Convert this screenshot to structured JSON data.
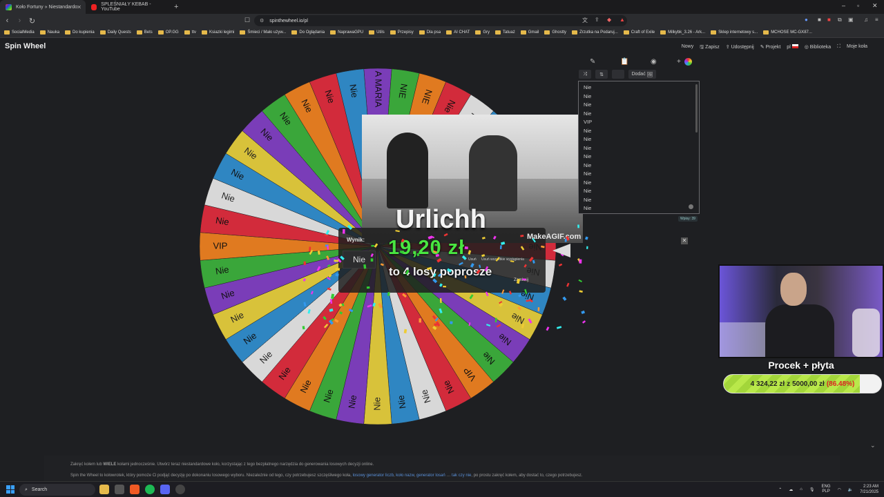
{
  "browser": {
    "tabs": [
      {
        "title": "Koło Fortuny » Niestandardo",
        "active": true
      },
      {
        "title": "SPLEŚNIAŁY KEBAB - YouTube",
        "active": false
      }
    ],
    "url": "spinthewheel.io/pl",
    "bookmarks": [
      "SocialMedia",
      "Nauka",
      "Do kupienia",
      "Daily Quests",
      "Bets",
      "OP.GG",
      "ttv",
      "Ksiazki legimi",
      "Śmieci / Mało używ...",
      "Do Oglądania",
      "NaprawaGPU",
      "Utils",
      "Przepisy",
      "Dla psa",
      "AI CHAT",
      "Gry",
      "Tatuaż",
      "Gmail",
      "Ghostty",
      "Zrzutka na Podaruj...",
      "Craft of Exile",
      "Milkybk_3.26 - Ark...",
      "Sklep internetowy s...",
      "MCHOSE MC-GX87..."
    ]
  },
  "site": {
    "logo": "Spin Wheel",
    "menu": [
      "Nowy",
      "Zapisz",
      "Udostępnij",
      "Projekt",
      "pl",
      "Biblioteka",
      "Moje koła"
    ]
  },
  "wheel": {
    "labels": [
      "A MARIA",
      "NIE",
      "NIE",
      "Nie",
      "Nie",
      "Nie",
      "Nie",
      "Nie",
      "Nie",
      "Nie",
      "Nie",
      "Nie",
      "Nie",
      "Nie",
      "Nie",
      "Nie",
      "VIP",
      "Nie",
      "Nie",
      "Nie",
      "Nie",
      "Nie",
      "Nie",
      "Nie",
      "Nie",
      "Nie",
      "Nie",
      "Nie",
      "Nie",
      "Nie",
      "VIP",
      "Nie",
      "Nie",
      "Nie",
      "Nie",
      "Nie",
      "Nie",
      "Nie",
      "Nie",
      "Nie"
    ],
    "colors": [
      "#7a3db8",
      "#3aa63a",
      "#e07a20",
      "#d22b3b",
      "#d8d8d8",
      "#2f86c2",
      "#d8c23a",
      "#7a3db8",
      "#3aa63a",
      "#e07a20",
      "#d22b3b",
      "#d8d8d8",
      "#2f86c2",
      "#d8c23a",
      "#7a3db8",
      "#3aa63a",
      "#e07a20",
      "#d22b3b",
      "#d8d8d8",
      "#2f86c2",
      "#d8c23a",
      "#7a3db8",
      "#3aa63a",
      "#e07a20",
      "#d22b3b",
      "#d8d8d8",
      "#2f86c2",
      "#d8c23a",
      "#7a3db8",
      "#3aa63a",
      "#e07a20",
      "#d22b3b",
      "#d8d8d8",
      "#2f86c2",
      "#d8c23a",
      "#7a3db8",
      "#3aa63a",
      "#e07a20",
      "#d22b3b",
      "#2f86c2"
    ]
  },
  "alert": {
    "title": "Urlichh",
    "amount": "19,20 zł",
    "message": "to 4 losy poprosze",
    "watermark": "MakeAGIF.com"
  },
  "result_dialog": {
    "label": "Wynik:",
    "value": "Nie",
    "remove": "Usuń",
    "remove_all": "Usuń wszystkie wystąpienia",
    "close": "Zamknij"
  },
  "panel": {
    "add_button": "Dodać",
    "entries": [
      "Nie",
      "Nie",
      "Nie",
      "Nie",
      "VIP",
      "Nie",
      "Nie",
      "Nie",
      "Nie",
      "Nie",
      "Nie",
      "Nie",
      "Nie",
      "Nie",
      "Nie"
    ],
    "count": "Wpisy: 39"
  },
  "goal": {
    "title": "Procek + płyta",
    "current": "4 324,22 zł",
    "separator": "z",
    "target": "5000,00 zł",
    "percent_text": "(86.48%)",
    "progress": 0.8648
  },
  "footer": {
    "line1_prefix": "Zakręć kołem lub ",
    "line1_bold": "WIELE",
    "line1_rest": " kołami jednocześnie. Utwórz teraz niestandardowe koło, korzystając z tego bezpłatnego narzędzia do generowania losowych decyzji online.",
    "line2": "Spin the Wheel to kołowrotek, który pomoże Ci podjąć decyzję po dokonaniu losowego wyboru. Niezależnie od tego, czy potrzebujesz szczęśliwego koła, ",
    "links": [
      "losowy generator liczb",
      "koło nazw",
      "generator losań",
      "",
      "",
      "tak czy nie"
    ],
    "line2_end": ", po prostu zakręć kołem, aby dostać to, czego potrzebujesz."
  },
  "taskbar": {
    "search_placeholder": "Search",
    "lang": "ENG",
    "lang2": "PLP",
    "time": "2:23 AM",
    "date": "7/21/2025"
  }
}
